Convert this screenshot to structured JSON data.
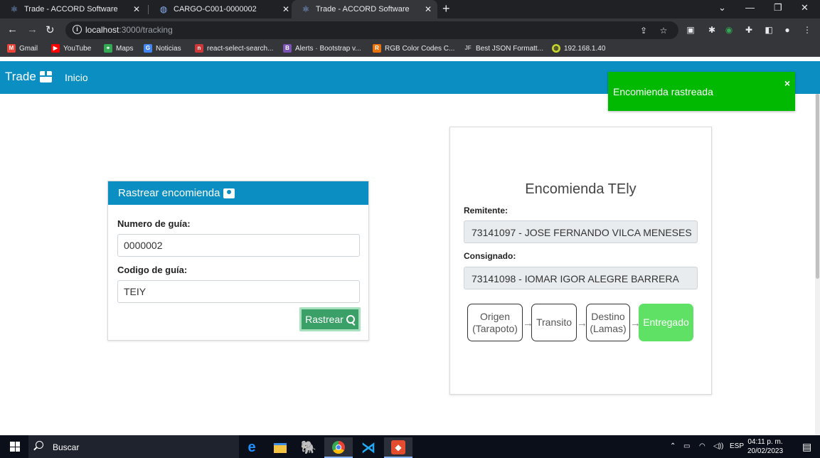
{
  "browser": {
    "tabs": [
      {
        "title": "Trade - ACCORD Software",
        "active": false
      },
      {
        "title": "CARGO-C001-0000002",
        "active": false
      },
      {
        "title": "Trade - ACCORD Software",
        "active": true
      }
    ],
    "url_host": "localhost",
    "url_rest": ":3000/tracking",
    "bookmarks": [
      {
        "label": "Gmail",
        "icon": "gmail-icon",
        "color": "#ea4335"
      },
      {
        "label": "YouTube",
        "icon": "youtube-icon",
        "color": "#ff0000"
      },
      {
        "label": "Maps",
        "icon": "maps-icon",
        "color": "#34a853"
      },
      {
        "label": "Noticias",
        "icon": "news-icon",
        "color": "#4285f4"
      },
      {
        "label": "react-select-search...",
        "icon": "npm-icon",
        "color": "#cb3837"
      },
      {
        "label": "Alerts · Bootstrap v...",
        "icon": "bootstrap-icon",
        "color": "#7952b3"
      },
      {
        "label": "RGB Color Codes C...",
        "icon": "rgb-icon",
        "color": "#e8710a"
      },
      {
        "label": "Best JSON Formatt...",
        "icon": "json-icon",
        "color": "#35363a"
      },
      {
        "label": "192.168.1.40",
        "icon": "globe-icon",
        "color": "#c5d52a"
      }
    ]
  },
  "app": {
    "brand": "Trade",
    "nav_home": "Inicio",
    "toast": {
      "message": "Encomienda rastreada",
      "close": "×",
      "color": "#00b900"
    },
    "search_card": {
      "title": "Rastrear encomienda",
      "guide_number_label": "Numero de guía:",
      "guide_number_value": "0000002",
      "guide_code_label": "Codigo de guía:",
      "guide_code_value": "TEIY",
      "track_button": "Rastrear"
    },
    "result_card": {
      "title": "Encomienda TEly",
      "sender_label": "Remitente:",
      "sender_value": "73141097 - JOSE FERNANDO VILCA MENESES",
      "consignee_label": "Consignado:",
      "consignee_value": "73141098 - IOMAR IGOR ALEGRE BARRERA",
      "steps": [
        {
          "line1": "Origen",
          "line2": "(Tarapoto)",
          "done": false
        },
        {
          "line1": "Transito",
          "line2": "",
          "done": false
        },
        {
          "line1": "Destino",
          "line2": "(Lamas)",
          "done": false
        },
        {
          "line1": "Entregado",
          "line2": "",
          "done": true
        }
      ]
    },
    "accent_color": "#0b8fc2"
  },
  "taskbar": {
    "search_placeholder": "Buscar",
    "language": "ESP",
    "time": "04:11 p. m.",
    "date": "20/02/2023"
  }
}
